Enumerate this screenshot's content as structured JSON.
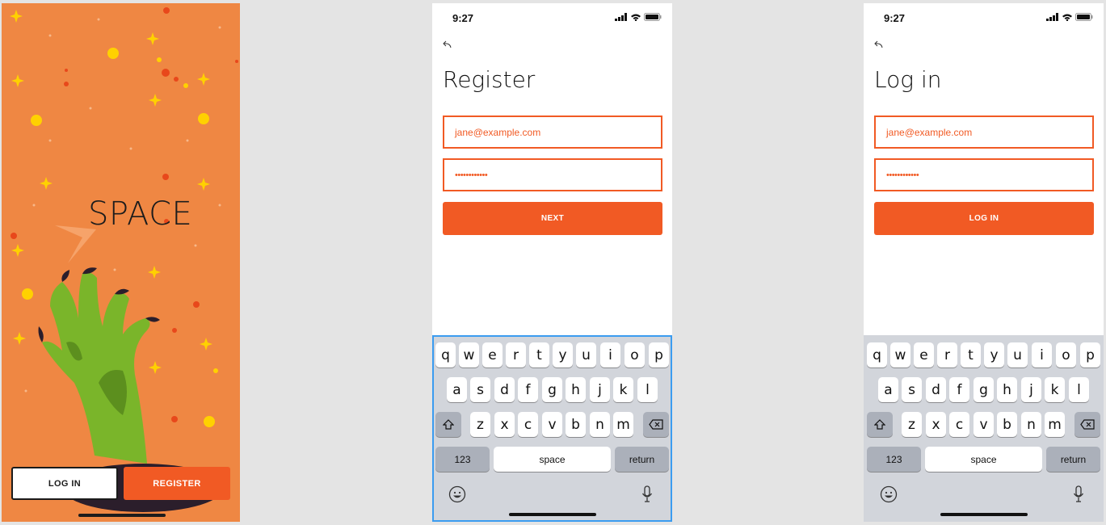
{
  "splash": {
    "brand": "SPACE",
    "login_label": "LOG IN",
    "register_label": "REGISTER",
    "colors": {
      "background": "#ef8743",
      "accent": "#f15a24"
    }
  },
  "register_screen": {
    "time": "9:27",
    "heading": "Register",
    "email_value": "jane@example.com",
    "password_value": "••••••••••••",
    "primary_label": "NEXT"
  },
  "login_screen": {
    "time": "9:27",
    "heading": "Log in",
    "email_value": "jane@example.com",
    "password_value": "••••••••••••",
    "primary_label": "LOG IN"
  },
  "keyboard": {
    "row1": [
      "q",
      "w",
      "e",
      "r",
      "t",
      "y",
      "u",
      "i",
      "o",
      "p"
    ],
    "row2": [
      "a",
      "s",
      "d",
      "f",
      "g",
      "h",
      "j",
      "k",
      "l"
    ],
    "row3": [
      "z",
      "x",
      "c",
      "v",
      "b",
      "n",
      "m"
    ],
    "numbers_label": "123",
    "space_label": "space",
    "return_label": "return",
    "icons": [
      "shift-icon",
      "delete-icon",
      "emoji-icon",
      "microphone-icon"
    ]
  }
}
